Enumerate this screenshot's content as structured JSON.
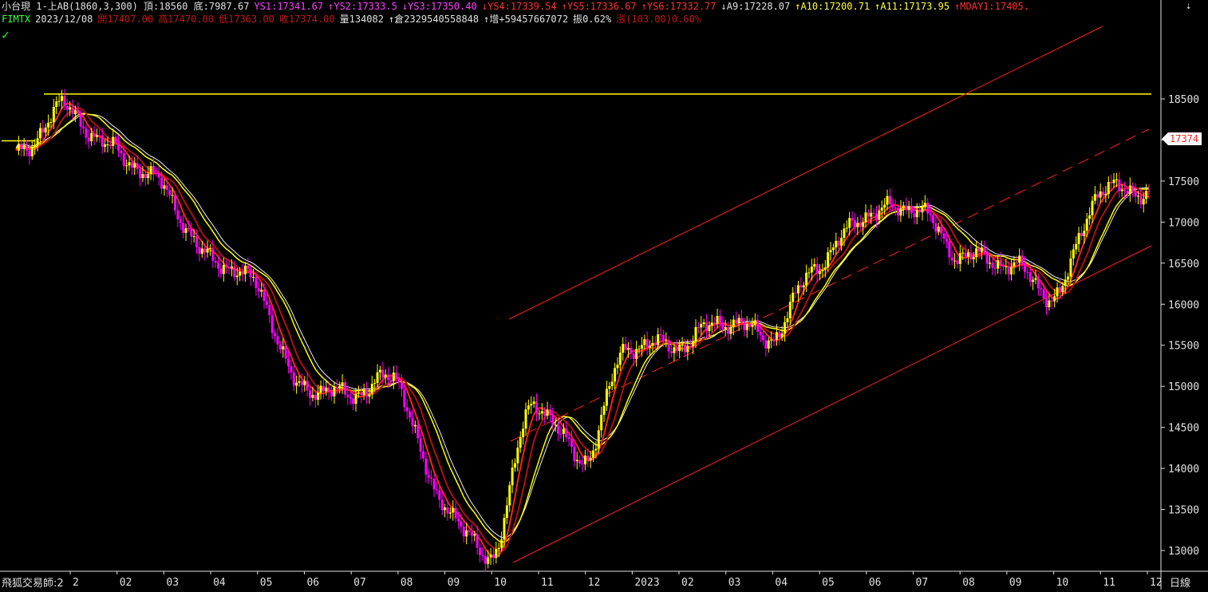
{
  "header": {
    "line1": [
      {
        "text": "小台現 1-上AB(1860,3,300) 頂:18560 底:7987.67",
        "color": "white"
      },
      {
        "text": "YS1:17341.67",
        "color": "magenta"
      },
      {
        "text": "↑YS2:17333.5",
        "color": "magenta"
      },
      {
        "text": "↓YS3:17350.40",
        "color": "magenta"
      },
      {
        "text": "↓YS4:17339.54",
        "color": "red"
      },
      {
        "text": "↑YS5:17336.67",
        "color": "red"
      },
      {
        "text": "↑YS6:17332.77",
        "color": "red"
      },
      {
        "text": "↓A9:17228.07",
        "color": "white"
      },
      {
        "text": "↑A10:17200.71",
        "color": "yellow"
      },
      {
        "text": "↑A11:17173.95",
        "color": "yellow"
      },
      {
        "text": "↑MDAY1:17405.",
        "color": "red"
      }
    ],
    "line2": [
      {
        "text": "FIMTX",
        "color": "green"
      },
      {
        "text": "2023/12/08",
        "color": "white"
      },
      {
        "text": "開17407.00",
        "color": "darkred"
      },
      {
        "text": "高17470.00",
        "color": "darkred"
      },
      {
        "text": "低17363.00",
        "color": "darkred"
      },
      {
        "text": "收17374.00",
        "color": "darkred"
      },
      {
        "text": "量134082",
        "color": "white"
      },
      {
        "text": "↑倉2329540558848",
        "color": "white"
      },
      {
        "text": "↑增+59457667072",
        "color": "white"
      },
      {
        "text": "振0.62%",
        "color": "white"
      },
      {
        "text": "漲(103.00)0.60%",
        "color": "darkred"
      }
    ]
  },
  "footer": {
    "label": "飛狐交易師:2",
    "period": "日線"
  },
  "last_price_badge": "17374",
  "colors": {
    "background": "#000000",
    "up_candle": "#ffff00",
    "down_candle": "#ff00ff",
    "ma_red": "#ff2020",
    "ma_darkred": "#b01010",
    "ma_yellow": "#ffff00",
    "ma_white": "#f0f0f0",
    "trendline": "#ff2020",
    "axis": "#e0e0e0"
  },
  "icons": {
    "check": "check-icon",
    "scroll": "scroll-down-icon"
  },
  "chart_data": {
    "type": "candlestick",
    "x_ticks": [
      "2",
      "02",
      "03",
      "04",
      "05",
      "06",
      "07",
      "08",
      "09",
      "10",
      "11",
      "12",
      "2023",
      "02",
      "03",
      "04",
      "05",
      "06",
      "07",
      "08",
      "09",
      "10",
      "11",
      "12"
    ],
    "y_ticks": [
      13000,
      13500,
      14000,
      14500,
      15000,
      15500,
      16000,
      16500,
      17000,
      17500,
      18000,
      18500
    ],
    "ylim": [
      12700,
      18700
    ],
    "resistance_level": 18560,
    "series_close": [
      {
        "month": "2021-12",
        "value": 17800
      },
      {
        "month": "2022-01",
        "value": 18400
      },
      {
        "month": "2022-02",
        "value": 17900
      },
      {
        "month": "2022-03",
        "value": 17500
      },
      {
        "month": "2022-04",
        "value": 16600
      },
      {
        "month": "2022-05",
        "value": 16300
      },
      {
        "month": "2022-06",
        "value": 15000
      },
      {
        "month": "2022-07",
        "value": 14900
      },
      {
        "month": "2022-08",
        "value": 15100
      },
      {
        "month": "2022-09",
        "value": 13600
      },
      {
        "month": "2022-10",
        "value": 12900
      },
      {
        "month": "2022-11",
        "value": 14800
      },
      {
        "month": "2022-12",
        "value": 14100
      },
      {
        "month": "2023-01",
        "value": 15500
      },
      {
        "month": "2023-02",
        "value": 15500
      },
      {
        "month": "2023-03",
        "value": 15800
      },
      {
        "month": "2023-04",
        "value": 15600
      },
      {
        "month": "2023-05",
        "value": 16500
      },
      {
        "month": "2023-06",
        "value": 17100
      },
      {
        "month": "2023-07",
        "value": 17200
      },
      {
        "month": "2023-08",
        "value": 16600
      },
      {
        "month": "2023-09",
        "value": 16500
      },
      {
        "month": "2023-10",
        "value": 16100
      },
      {
        "month": "2023-11",
        "value": 17400
      },
      {
        "month": "2023-12",
        "value": 17374
      }
    ],
    "last_bar": {
      "date": "2023/12/08",
      "open": 17407,
      "high": 17470,
      "low": 17363,
      "close": 17374
    }
  }
}
